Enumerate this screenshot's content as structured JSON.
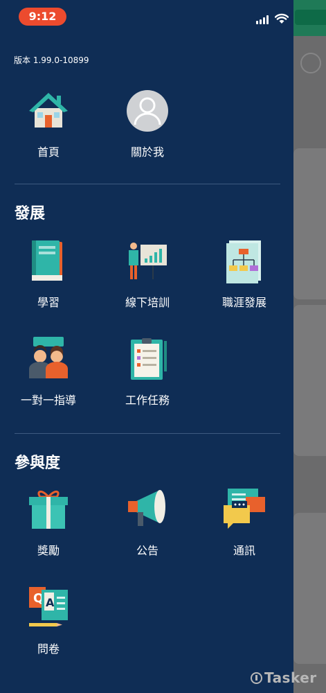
{
  "status_bar": {
    "time": "9:12"
  },
  "drawer": {
    "version": "版本 1.99.0-10899",
    "top_items": [
      {
        "label": "首頁",
        "icon": "home-icon"
      },
      {
        "label": "關於我",
        "icon": "profile-avatar-icon"
      }
    ],
    "sections": [
      {
        "title": "發展",
        "items": [
          {
            "label": "學習",
            "icon": "book-icon"
          },
          {
            "label": "線下培訓",
            "icon": "presentation-icon"
          },
          {
            "label": "職涯發展",
            "icon": "career-chart-icon"
          },
          {
            "label": "一對一指導",
            "icon": "mentoring-icon"
          },
          {
            "label": "工作任務",
            "icon": "clipboard-icon"
          }
        ]
      },
      {
        "title": "參與度",
        "items": [
          {
            "label": "獎勵",
            "icon": "gift-icon"
          },
          {
            "label": "公告",
            "icon": "megaphone-icon"
          },
          {
            "label": "通訊",
            "icon": "chat-bubbles-icon"
          },
          {
            "label": "問卷",
            "icon": "survey-icon"
          }
        ]
      }
    ]
  },
  "watermark": "Tasker",
  "colors": {
    "drawer_bg": "#0f2d55",
    "time_pill": "#ec4b2e",
    "divider": "#3d5a80",
    "header_green": "#1f7a57"
  }
}
